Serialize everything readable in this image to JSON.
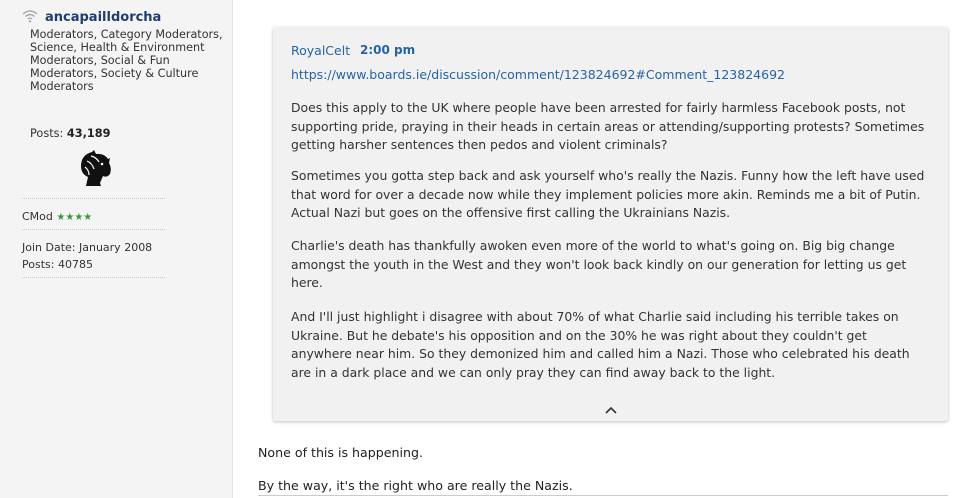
{
  "author": {
    "status_icon": "wifi-icon",
    "username": "ancapailldorcha",
    "roles": "Moderators, Category Moderators, Science, Health & Environment Moderators, Social & Fun Moderators, Society & Culture Moderators",
    "posts_label": "Posts:",
    "posts_count": "43,189",
    "avatar_icon": "horse-head-icon",
    "rank_label": "CMod",
    "rank_stars": "★★★★",
    "join_date": "Join Date: January 2008",
    "posts_total": "Posts: 40785"
  },
  "quote": {
    "author": "RoyalCelt",
    "time": "2:00 pm",
    "link": "https://www.boards.ie/discussion/comment/123824692#Comment_123824692",
    "paragraphs": [
      "Does this apply to the UK where people have been arrested for fairly harmless Facebook posts, not supporting pride, praying in their heads in certain areas or attending/supporting protests? Sometimes getting harsher sentences then pedos and violent criminals?",
      "Sometimes you gotta step back and ask yourself who's really the Nazis. Funny how the left have used that word for over a decade now while they implement policies more akin. Reminds me a bit of Putin. Actual Nazi but goes on the offensive first calling the Ukrainians Nazis.",
      "Charlie's death has thankfully awoken even more of the world to what's going on. Big big change amongst the youth in the West and they won't look back kindly on our generation for letting us get here.",
      "And I'll just highlight i disagree with about 70% of what Charlie said including his terrible takes on Ukraine. But he debate's his opposition and on the 30% he was right about they couldn't get anywhere near him. So they demonized him and called him a Nazi. Those who celebrated his death are in a dark place and we can only pray they can find away back to the light."
    ],
    "collapse_icon": "chevron-up-icon"
  },
  "reply": {
    "lines": [
      "None of this is happening.",
      "By the way, it's the right who are really the Nazis."
    ]
  }
}
